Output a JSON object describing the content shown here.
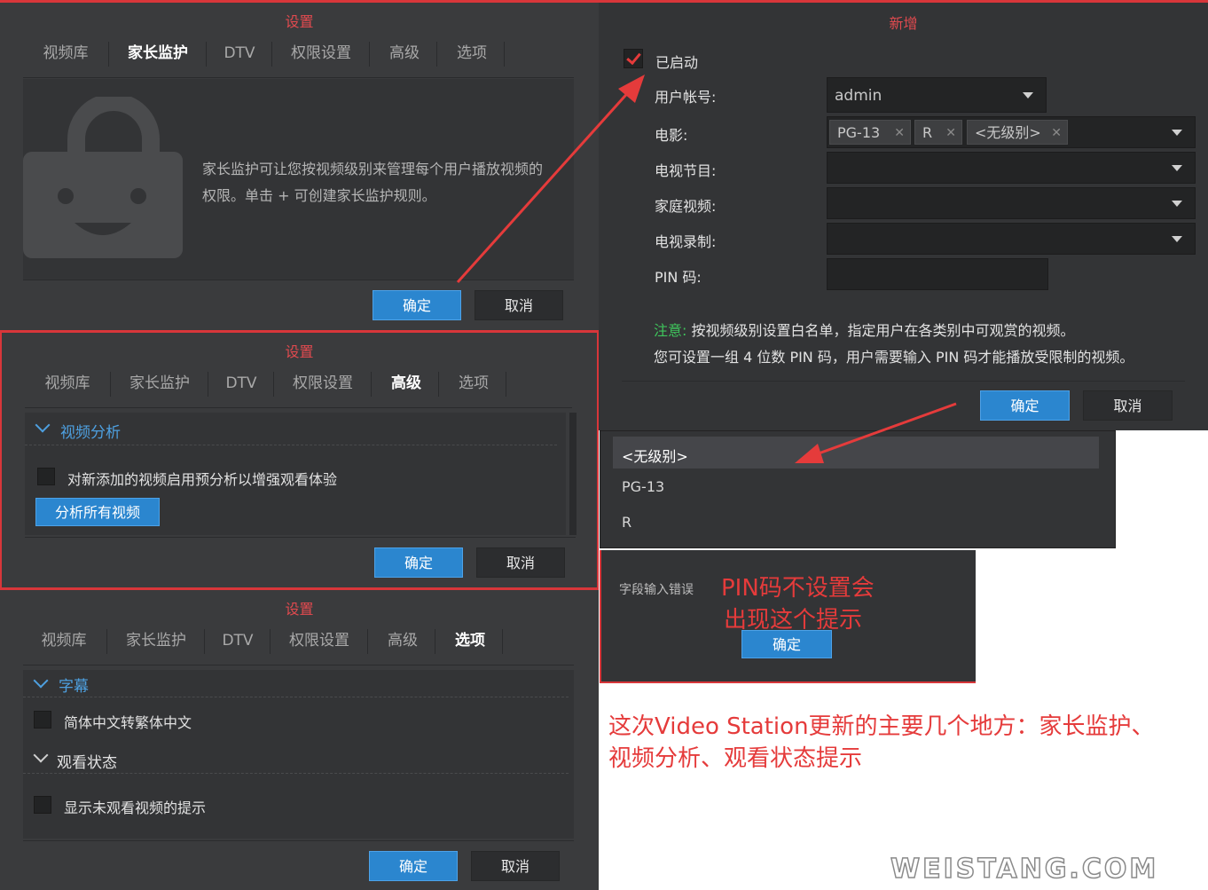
{
  "panel_parental": {
    "title": "设置",
    "tabs": [
      "视频库",
      "家长监护",
      "DTV",
      "权限设置",
      "高级",
      "选项"
    ],
    "description_line1": "家长监护可让您按视频级别来管理每个用户播放视频的",
    "description_line2": "权限。单击 + 可创建家长监护规则。",
    "ok": "确定",
    "cancel": "取消"
  },
  "panel_advanced": {
    "title": "设置",
    "tabs": [
      "视频库",
      "家长监护",
      "DTV",
      "权限设置",
      "高级",
      "选项"
    ],
    "section": "视频分析",
    "checkbox_label": "对新添加的视频启用预分析以增强观看体验",
    "analyze_button": "分析所有视频",
    "ok": "确定",
    "cancel": "取消"
  },
  "panel_options": {
    "title": "设置",
    "tabs": [
      "视频库",
      "家长监护",
      "DTV",
      "权限设置",
      "高级",
      "选项"
    ],
    "section_subtitles": "字幕",
    "checkbox_subtitles": "简体中文转繁体中文",
    "section_watch": "观看状态",
    "checkbox_watch": "显示未观看视频的提示",
    "ok": "确定",
    "cancel": "取消"
  },
  "panel_new": {
    "title": "新增",
    "enabled_label": "已启动",
    "user_label": "用户帐号:",
    "user_value": "admin",
    "movie_label": "电影:",
    "movie_chips": [
      "PG-13",
      "R",
      "<无级别>"
    ],
    "tv_label": "电视节目:",
    "home_label": "家庭视频:",
    "rec_label": "电视录制:",
    "pin_label": "PIN 码:",
    "note_prefix": "注意:",
    "note_line1": " 按视频级别设置白名单，指定用户在各类别中可观赏的视频。",
    "note_line2": "您可设置一组 4 位数 PIN 码，用户需要输入 PIN 码才能播放受限制的视频。",
    "ok": "确定",
    "cancel": "取消"
  },
  "dropdown_list": {
    "items": [
      "<无级别>",
      "PG-13",
      "R"
    ]
  },
  "error_dialog": {
    "message": "字段输入错误",
    "ok": "确定"
  },
  "annotations": {
    "pin_note_line1": "PIN码不设置会",
    "pin_note_line2": "出现这个提示",
    "summary_line1": "这次Video Station更新的主要几个地方：家长监护、",
    "summary_line2": "视频分析、观看状态提示"
  },
  "watermark": "WEISTANG.COM",
  "colors": {
    "accent_red": "#e53b3b",
    "primary_blue": "#2b86cf",
    "section_blue": "#4ea0e0",
    "note_green": "#3fc55c"
  }
}
